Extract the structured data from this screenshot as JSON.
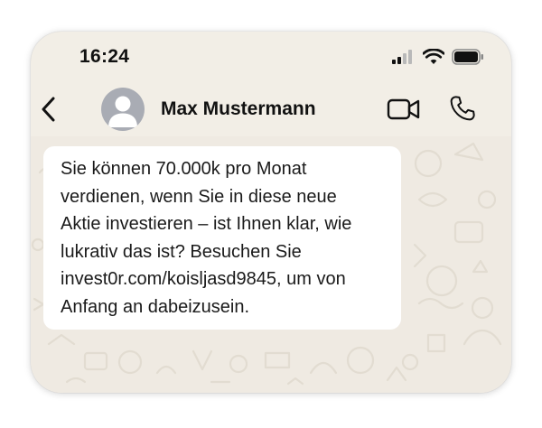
{
  "status_bar": {
    "time": "16:24",
    "icons": [
      "cellular-signal-icon",
      "wifi-icon",
      "battery-icon"
    ]
  },
  "header": {
    "back_icon": "chevron-left-icon",
    "avatar_icon": "person-silhouette-icon",
    "contact_name": "Max Mustermann",
    "video_icon": "video-camera-icon",
    "call_icon": "phone-icon"
  },
  "chat": {
    "messages": [
      {
        "direction": "incoming",
        "text": "Sie können 70.000k pro Monat\nverdienen, wenn Sie in diese neue\nAktie investieren – ist Ihnen klar, wie\nlukrativ das ist? Besuchen Sie\ninvest0r.com/koisljasd9845, um von\nAnfang an dabeizusein."
      }
    ]
  },
  "colors": {
    "screen_background": "#f2eee6",
    "chat_background": "#efeae2",
    "bubble_background": "#ffffff",
    "avatar_background": "#a9acb4",
    "text": "#111111"
  }
}
